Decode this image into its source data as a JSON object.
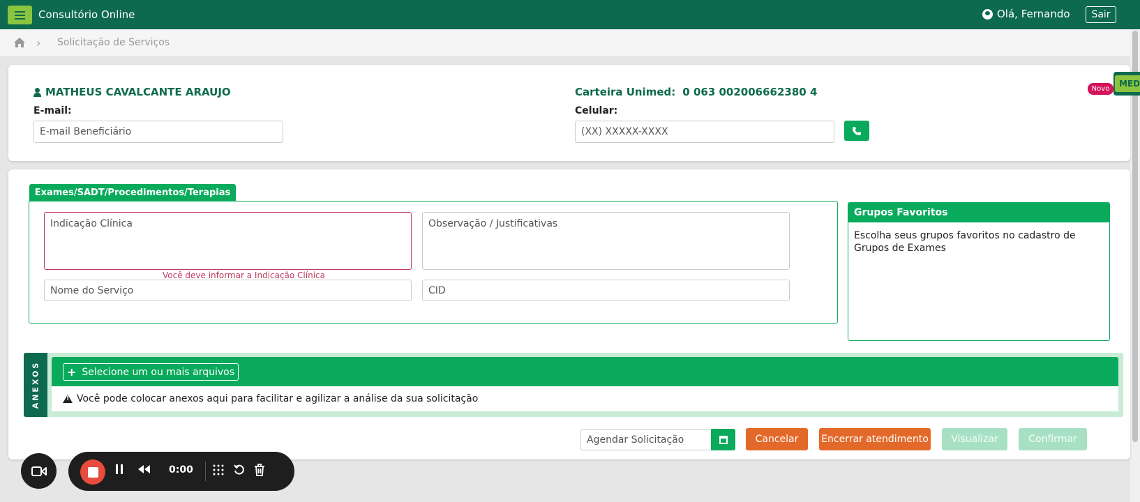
{
  "header": {
    "app_title": "Consultório Online",
    "greeting": "Olá, Fernando",
    "logout_label": "Sair"
  },
  "breadcrumb": {
    "current": "Solicitação de Serviços"
  },
  "patient": {
    "name": "MATHEUS CAVALCANTE ARAUJO",
    "card_label": "Carteira Unimed:",
    "card_number": "0 063 002006662380 4",
    "email_label": "E-mail:",
    "email_placeholder": "E-mail Beneficiário",
    "phone_label": "Celular:",
    "phone_placeholder": "(XX) XXXXX-XXXX",
    "badge_new": "Novo",
    "badge_med": "MED"
  },
  "form": {
    "tab_label": "Exames/SADT/Procedimentos/Terapias",
    "clinical_placeholder": "Indicação Clínica",
    "clinical_error": "Você deve informar a Indicação Clínica",
    "observation_placeholder": "Observação / Justificativas",
    "service_placeholder": "Nome do Serviço",
    "cid_placeholder": "CID"
  },
  "favorites": {
    "title": "Grupos Favoritos",
    "message": "Escolha seus grupos favoritos no cadastro de Grupos de Exames"
  },
  "attachments": {
    "side_label": "ANEXOS",
    "select_button": "Selecione um ou mais arquivos",
    "note": "Você pode colocar anexos aqui para facilitar e agilizar a análise da sua solicitação"
  },
  "actions": {
    "schedule_placeholder": "Agendar Solicitação",
    "cancel": "Cancelar",
    "end_session": "Encerrar atendimento",
    "preview": "Visualizar",
    "confirm": "Confirmar"
  },
  "recorder": {
    "time": "0:00"
  },
  "colors": {
    "brand_dark": "#0d6a4e",
    "brand_green": "#0aaa5c",
    "accent_lime": "#8bc53f",
    "orange": "#e3692a",
    "error": "#c0395f"
  }
}
